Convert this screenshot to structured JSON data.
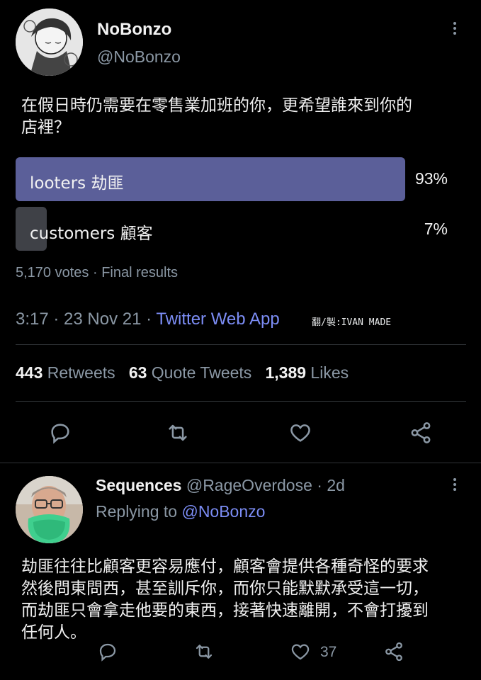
{
  "tweet": {
    "display_name": "NoBonzo",
    "handle": "@NoBonzo",
    "text_line1": "在假日時仍需要在零售業加班的你，更希望誰來到你的",
    "text_line2": "店裡？",
    "poll": {
      "options": [
        {
          "label": "looters 劫匪",
          "percent": "93%",
          "value": 93
        },
        {
          "label": "customers 顧客",
          "percent": "7%",
          "value": 7
        }
      ],
      "votes": "5,170 votes",
      "separator": "·",
      "status": "Final results",
      "leading_color": "#5b5f99",
      "other_color": "#3f4147"
    },
    "time": "3:17",
    "date": "· 23 Nov 21 ·",
    "source": "Twitter Web App",
    "credit": "翻/製:IVAN MADE",
    "stats": {
      "retweets_count": "443",
      "retweets_label": "Retweets",
      "quotes_count": "63",
      "quotes_label": "Quote Tweets",
      "likes_count": "1,389",
      "likes_label": "Likes"
    }
  },
  "reply": {
    "display_name": "Sequences",
    "handle_time": "@RageOverdose · 2d",
    "replying_prefix": "Replying to",
    "replying_to": "@NoBonzo",
    "text_lines": [
      "劫匪往往比顧客更容易應付，顧客會提供各種奇怪的要求",
      "然後問東問西，甚至訓斥你，而你只能默默承受這一切，",
      "而劫匪只會拿走他要的東西，接著快速離開，不會打擾到",
      "任何人。"
    ],
    "like_count": "37"
  },
  "icons": {
    "reply": "reply-icon",
    "retweet": "retweet-icon",
    "like": "heart-icon",
    "share": "share-icon",
    "more": "more-icon"
  }
}
